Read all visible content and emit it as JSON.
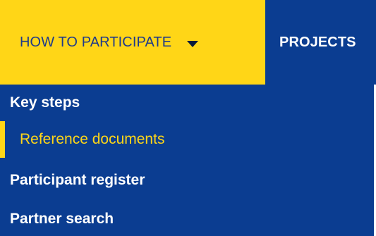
{
  "nav": {
    "active_item": "HOW TO PARTICIPATE",
    "next_item": "PROJECTS"
  },
  "dropdown": {
    "items": [
      {
        "label": "Key steps"
      },
      {
        "label": "Reference documents"
      },
      {
        "label": "Participant register"
      },
      {
        "label": "Partner search"
      }
    ],
    "current_index": 1
  },
  "colors": {
    "accent_yellow": "#ffd617",
    "nav_blue": "#0b3d91",
    "text_dark_blue": "#1f3a8a"
  },
  "icons": {
    "dropdown_caret": "caret-down-icon"
  }
}
